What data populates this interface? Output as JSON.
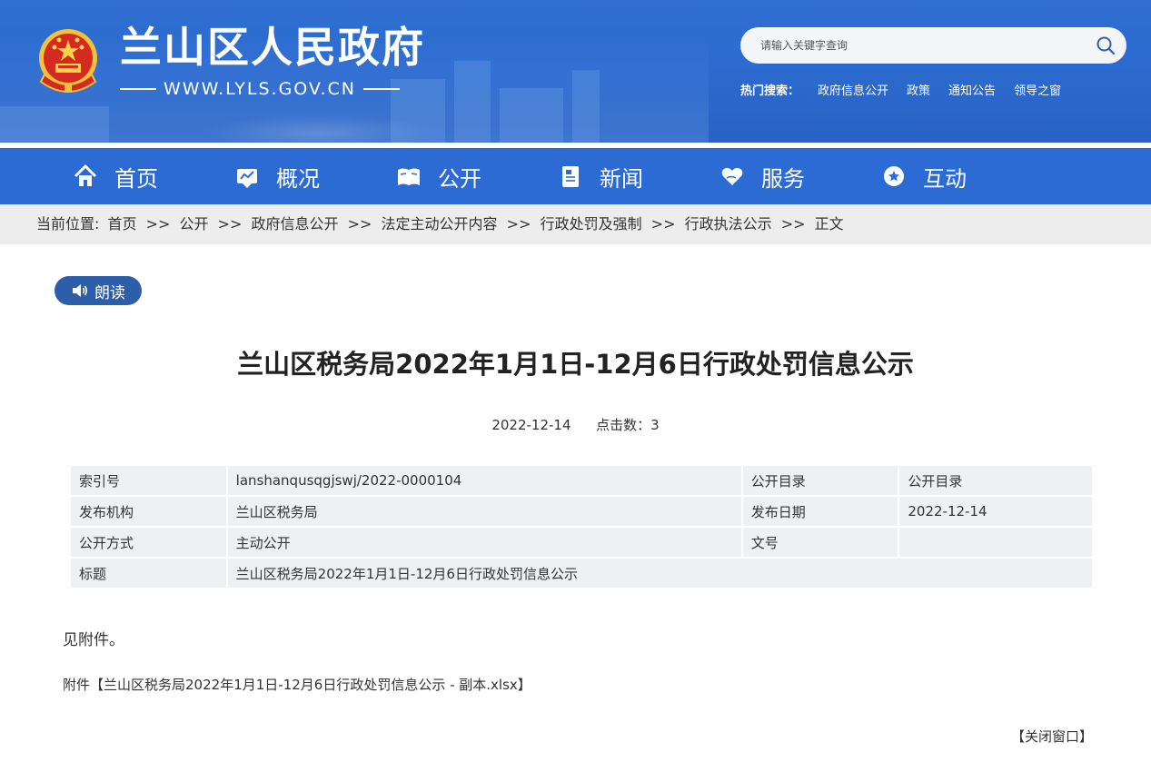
{
  "header": {
    "site_title": "兰山区人民政府",
    "site_url": "WWW.LYLS.GOV.CN",
    "emblem_icon": "national-emblem-icon",
    "search": {
      "placeholder": "请输入关键字查询",
      "icon": "search-icon"
    },
    "hot_search": {
      "label": "热门搜索：",
      "items": [
        "政府信息公开",
        "政策",
        "通知公告",
        "领导之窗"
      ]
    },
    "colors": {
      "header_bg": "#2c6bd0",
      "nav_bg": "#2b6bd3"
    }
  },
  "nav": {
    "items": [
      {
        "label": "首页",
        "icon": "home-icon"
      },
      {
        "label": "概况",
        "icon": "overview-icon"
      },
      {
        "label": "公开",
        "icon": "open-book-icon"
      },
      {
        "label": "新闻",
        "icon": "news-icon"
      },
      {
        "label": "服务",
        "icon": "heart-hand-icon"
      },
      {
        "label": "互动",
        "icon": "chat-star-icon"
      }
    ]
  },
  "breadcrumb": {
    "prefix": "当前位置:",
    "separator": ">>",
    "items": [
      "首页",
      "公开",
      "政府信息公开",
      "法定主动公开内容",
      "行政处罚及强制",
      "行政执法公示",
      "正文"
    ]
  },
  "reader": {
    "label": "朗读",
    "icon": "speaker-icon",
    "color": "#2d5ea9"
  },
  "article": {
    "title": "兰山区税务局2022年1月1日-12月6日行政处罚信息公示",
    "date": "2022-12-14",
    "clicks_label": "点击数：",
    "clicks": "3",
    "info": {
      "index_label": "索引号",
      "index_value": "lanshanqusqgjswj/2022-0000104",
      "catalog_label": "公开目录",
      "catalog_value": "公开目录",
      "publisher_label": "发布机构",
      "publisher_value": "兰山区税务局",
      "pubdate_label": "发布日期",
      "pubdate_value": "2022-12-14",
      "method_label": "公开方式",
      "method_value": "主动公开",
      "docno_label": "文号",
      "docno_value": "",
      "title_label": "标题",
      "title_value": "兰山区税务局2022年1月1日-12月6日行政处罚信息公示"
    },
    "body": "见附件。",
    "attachment_prefix": "附件【",
    "attachment_name": "兰山区税务局2022年1月1日-12月6日行政处罚信息公示 - 副本.xlsx",
    "attachment_suffix": "】"
  },
  "footer": {
    "close_label": "【关闭窗口】"
  }
}
